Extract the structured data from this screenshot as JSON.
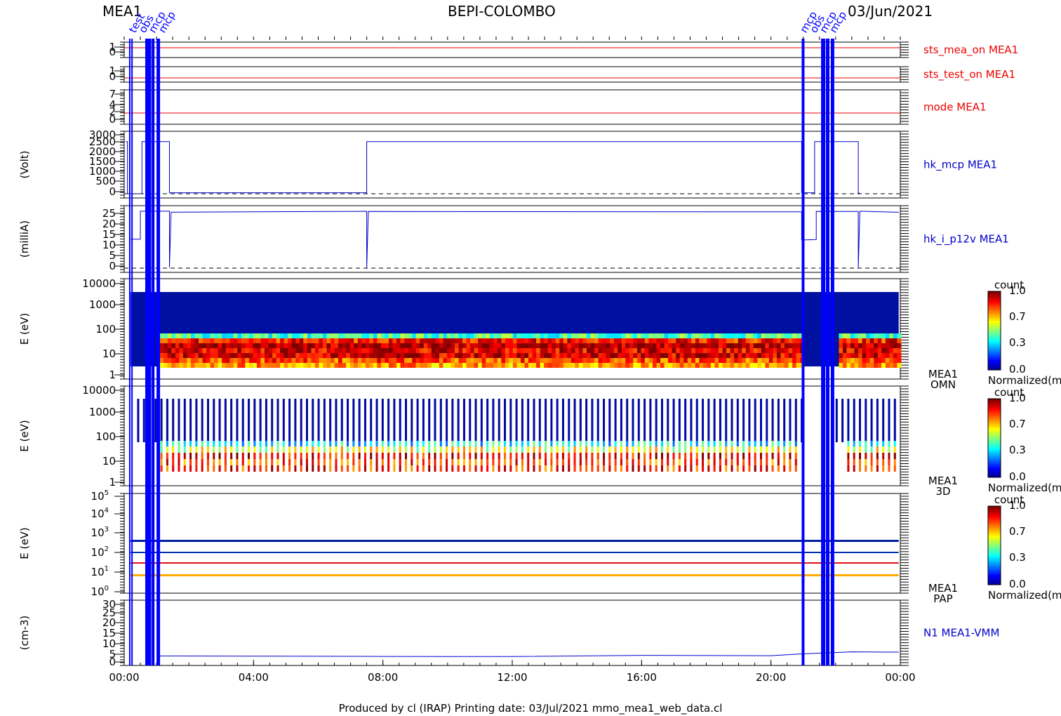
{
  "header": {
    "left": "MEA1",
    "center": "BEPI-COLOMBO",
    "right": "03/Jun/2021"
  },
  "footer": "Produced by cl (IRAP)    Printing date: 03/Jul/2021    mmo_mea1_web_data.cl",
  "colors": {
    "red": "#ee0000",
    "blue": "#0000cc",
    "markerBlue": "#0000ff"
  },
  "chart_data": [
    {
      "type": "line",
      "panel_id": "sts_mea_on",
      "label": "sts_mea_on MEA1",
      "label_color": "red",
      "ticks": [
        "1",
        "0"
      ],
      "ylim": [
        0,
        1
      ],
      "x_ticks": [
        "00:00",
        "04:00",
        "08:00",
        "12:00",
        "16:00",
        "20:00",
        "00:00"
      ],
      "series": [
        {
          "points": [
            [
              0,
              1
            ],
            [
              24,
              1
            ]
          ]
        }
      ]
    },
    {
      "type": "line",
      "panel_id": "sts_test_on",
      "label": "sts_test_on MEA1",
      "label_color": "red",
      "ticks": [
        "1",
        "0"
      ],
      "ylim": [
        0,
        1
      ],
      "series": [
        {
          "points": [
            [
              0,
              0
            ],
            [
              24,
              0
            ]
          ]
        }
      ]
    },
    {
      "type": "line",
      "panel_id": "mode",
      "label": "mode MEA1",
      "label_color": "red",
      "ticks": [
        "7",
        "4",
        "2",
        "0"
      ],
      "ylim": [
        0,
        7
      ],
      "series": [
        {
          "points": [
            [
              0,
              2
            ],
            [
              24,
              2
            ]
          ]
        }
      ]
    },
    {
      "type": "line",
      "panel_id": "hk_mcp",
      "label": "hk_mcp MEA1",
      "label_color": "blue",
      "ylabel": "(Volt)",
      "ticks": [
        "3000",
        "2500",
        "2000",
        "1500",
        "1000",
        "500",
        "0"
      ],
      "ylim": [
        0,
        3000
      ],
      "series": [
        {
          "points": [
            [
              0.05,
              2750
            ],
            [
              0.1,
              2750
            ],
            [
              0.1,
              0
            ],
            [
              0.55,
              0
            ],
            [
              0.55,
              2750
            ],
            [
              0.9,
              2750
            ],
            [
              1.15,
              2750
            ],
            [
              1.4,
              2750
            ],
            [
              1.4,
              50
            ],
            [
              7.5,
              50
            ],
            [
              7.5,
              2750
            ],
            [
              7.55,
              2750
            ],
            [
              20.95,
              2750
            ],
            [
              20.95,
              50
            ],
            [
              21.35,
              50
            ],
            [
              21.35,
              2750
            ],
            [
              21.85,
              2750
            ],
            [
              22.7,
              2750
            ],
            [
              22.7,
              30
            ],
            [
              22.75,
              30
            ]
          ]
        }
      ]
    },
    {
      "type": "line",
      "panel_id": "hk_i_p12v",
      "label": "hk_i_p12v MEA1",
      "label_color": "blue",
      "ylabel": "(milliA)",
      "ticks": [
        "25",
        "20",
        "15",
        "10",
        "5",
        "0"
      ],
      "ylim": [
        0,
        25
      ],
      "series": [
        {
          "points": [
            [
              0.2,
              12.5
            ],
            [
              0.5,
              12.5
            ],
            [
              0.5,
              24.8
            ],
            [
              1.1,
              24.8
            ],
            [
              1.4,
              24.8
            ],
            [
              1.4,
              0.3
            ],
            [
              1.45,
              24.8
            ],
            [
              7.5,
              24.8
            ],
            [
              7.5,
              0.3
            ],
            [
              7.55,
              24.8
            ],
            [
              20.95,
              24.8
            ],
            [
              20.95,
              12.5
            ],
            [
              21.4,
              12.5
            ],
            [
              21.4,
              24.8
            ],
            [
              22.7,
              24.8
            ],
            [
              22.7,
              0.3
            ],
            [
              22.75,
              24.8
            ],
            [
              23.95,
              24.8
            ]
          ]
        }
      ]
    },
    {
      "type": "heatmap",
      "panel_id": "omni",
      "label": "MEA1",
      "label2": "OMN",
      "ylabel": "E (eV)",
      "ticks": [
        "10000",
        "1000",
        "100",
        "10",
        "1"
      ],
      "ylim": [
        1,
        10000
      ],
      "colorbar": {
        "title": "count",
        "ticks": [
          "1.0",
          "0.7",
          "0.3",
          "0.0"
        ],
        "caption": "Normalized(m"
      }
    },
    {
      "type": "heatmap",
      "panel_id": "3d",
      "label": "MEA1",
      "label2": "3D",
      "ylabel": "E (eV)",
      "ticks": [
        "10000",
        "1000",
        "100",
        "10",
        "1"
      ],
      "ylim": [
        1,
        10000
      ],
      "colorbar": {
        "title": "count",
        "ticks": [
          "1.0",
          "0.7",
          "0.3",
          "0.0"
        ],
        "caption": "Normalized(m"
      }
    },
    {
      "type": "heatmap",
      "panel_id": "pap",
      "label": "MEA1",
      "label2": "PAP",
      "ylabel": "E (eV)",
      "ticks": [
        [
          "10",
          "5"
        ],
        [
          "10",
          "4"
        ],
        [
          "10",
          "3"
        ],
        [
          "10",
          "2"
        ],
        [
          "10",
          "1"
        ],
        [
          "10",
          "0"
        ]
      ],
      "ylim": [
        1,
        100000
      ],
      "colorbar": {
        "title": "count",
        "ticks": [
          "1.0",
          "0.7",
          "0.3",
          "0.0"
        ],
        "caption": "Normalized(m"
      }
    },
    {
      "type": "line",
      "panel_id": "density",
      "label": "N1 MEA1-VMM",
      "label_color": "blue",
      "ylabel": "(cm-3)",
      "ticks": [
        "30",
        "25",
        "20",
        "15",
        "10",
        "5",
        "0"
      ],
      "ylim": [
        0,
        30
      ],
      "series": [
        {
          "points": [
            [
              1.1,
              3
            ],
            [
              4,
              3
            ],
            [
              8,
              2.4
            ],
            [
              12,
              2.6
            ],
            [
              16,
              3.1
            ],
            [
              20,
              3.2
            ],
            [
              20.9,
              4.2
            ],
            [
              22.5,
              5.2
            ],
            [
              23.95,
              5.0
            ]
          ]
        }
      ]
    }
  ],
  "markers": {
    "left_labels": [
      "test",
      "obs",
      "mcp",
      "mcp"
    ],
    "right_labels": [
      "mcp",
      "obs",
      "mcp",
      "mcp"
    ]
  }
}
